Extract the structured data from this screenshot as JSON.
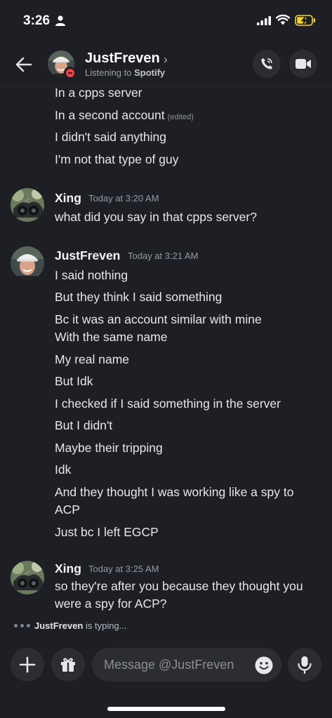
{
  "status_bar": {
    "time": "3:26"
  },
  "header": {
    "name": "JustFreven",
    "activity_prefix": "Listening to ",
    "activity_app": "Spotify"
  },
  "messages": [
    {
      "text": "In a cpps server"
    },
    {
      "text": "In a second account",
      "edited": "(edited)"
    },
    {
      "text": "I didn't said anything"
    },
    {
      "text": "I'm not that type of guy"
    },
    {
      "author": "Xing",
      "time": "Today at 3:20 AM",
      "text": "what did you say in that cpps server?"
    },
    {
      "author": "JustFreven",
      "time": "Today at 3:21 AM",
      "text": "I said nothing"
    },
    {
      "text": "But they think I said something"
    },
    {
      "text": "Bc it was an account similar with mine"
    },
    {
      "text": "With the same name"
    },
    {
      "text": "My real name"
    },
    {
      "text": "But Idk"
    },
    {
      "text": "I checked if I said something in the server"
    },
    {
      "text": "But I didn't"
    },
    {
      "text": "Maybe their tripping"
    },
    {
      "text": "Idk"
    },
    {
      "text": "And they thought I was working like a spy to"
    },
    {
      "text": "ACP"
    },
    {
      "text": "Just bc I left EGCP"
    },
    {
      "author": "Xing",
      "time": "Today at 3:25 AM",
      "text": "so they're after you because they thought you"
    },
    {
      "text": "were a spy for ACP?"
    }
  ],
  "typing": {
    "user": "JustFreven",
    "suffix": " is typing..."
  },
  "composer": {
    "placeholder": "Message @JustFreven"
  },
  "colors": {
    "background": "#1e1f24",
    "button": "#2c2d33",
    "dnd": "#f23f43",
    "battery": "#f7d51d"
  },
  "icons": [
    "person-icon",
    "signal-icon",
    "wifi-icon",
    "battery-charging-icon",
    "back-arrow-icon",
    "phone-call-icon",
    "video-camera-icon",
    "plus-icon",
    "gift-icon",
    "emoji-icon",
    "microphone-icon"
  ]
}
